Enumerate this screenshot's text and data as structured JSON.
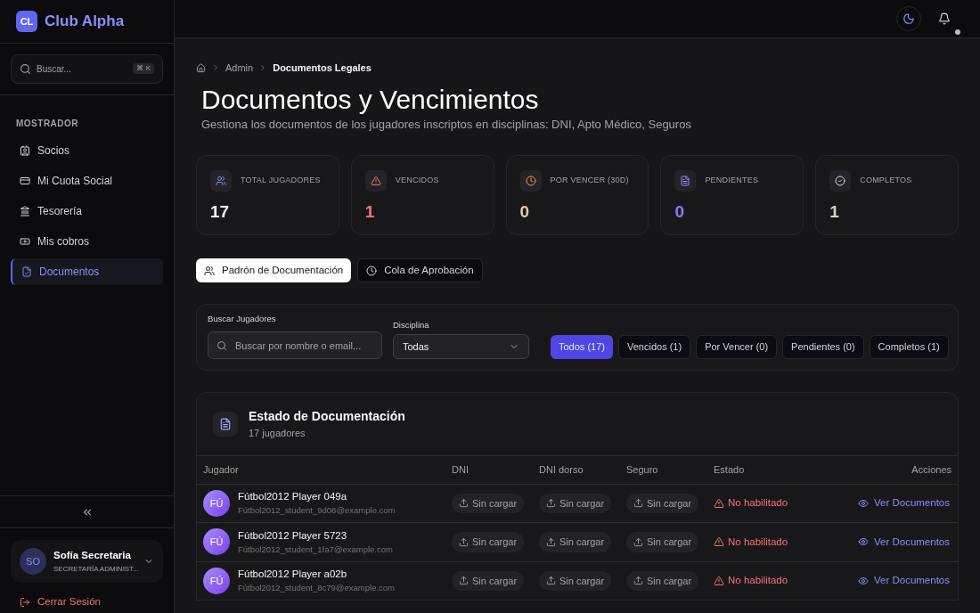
{
  "brand": {
    "logo": "CL",
    "name": "Club Alpha"
  },
  "sidebar": {
    "search": {
      "placeholder": "Buscar...",
      "shortcut": "⌘ K"
    },
    "section": "MOSTRADOR",
    "items": [
      {
        "label": "Socios",
        "selected": false
      },
      {
        "label": "Mi Cuota Social",
        "selected": false
      },
      {
        "label": "Tesorería",
        "selected": false
      },
      {
        "label": "Mis cobros",
        "selected": false
      },
      {
        "label": "Documentos",
        "selected": true
      }
    ],
    "user": {
      "initials": "SO",
      "name": "Sofía Secretaria",
      "role": "SECRETARÍA ADMINIST..."
    },
    "logout": "Cerrar Sesión"
  },
  "breadcrumb": [
    "Admin",
    "Documentos Legales"
  ],
  "title": "Documentos y Vencimientos",
  "subtitle": "Gestiona los documentos de los jugadores inscriptos en disciplinas: DNI, Apto Médico, Seguros",
  "stats": [
    {
      "label": "TOTAL JUGADORES",
      "value": "17",
      "color": "#f4f4f5"
    },
    {
      "label": "VENCIDOS",
      "value": "1",
      "color": "#f87171"
    },
    {
      "label": "POR VENCER (30D)",
      "value": "0",
      "color": "#e5c9a8"
    },
    {
      "label": "PENDIENTES",
      "value": "0",
      "color": "#8b7cf6"
    },
    {
      "label": "COMPLETOS",
      "value": "1",
      "color": "#d6d3c4"
    }
  ],
  "tabs": [
    {
      "label": "Padrón de Documentación",
      "selected": true
    },
    {
      "label": "Cola de Aprobación",
      "selected": false
    }
  ],
  "filters": {
    "search_label": "Buscar Jugadores",
    "search_placeholder": "Buscar por nombre o email...",
    "discipline_label": "Disciplina",
    "discipline_value": "Todas",
    "chips": [
      {
        "label": "Todos (17)",
        "selected": true
      },
      {
        "label": "Vencidos (1)",
        "selected": false
      },
      {
        "label": "Por Vencer (0)",
        "selected": false
      },
      {
        "label": "Pendientes (0)",
        "selected": false
      },
      {
        "label": "Completos (1)",
        "selected": false
      }
    ]
  },
  "table": {
    "title": "Estado de Documentación",
    "subtitle": "17 jugadores",
    "columns": [
      "Jugador",
      "DNI",
      "DNI dorso",
      "Seguro",
      "Estado",
      "Acciones"
    ],
    "rows": [
      {
        "initials": "FÚ",
        "name": "Fútbol2012 Player 049a",
        "email": "Fútbol2012_student_9d08@example.com",
        "dni": "Sin cargar",
        "dni_back": "Sin cargar",
        "insurance": "Sin cargar",
        "status": "No habilitado",
        "action": "Ver Documentos"
      },
      {
        "initials": "FÚ",
        "name": "Fútbol2012 Player 5723",
        "email": "Fútbol2012_student_1fa7@example.com",
        "dni": "Sin cargar",
        "dni_back": "Sin cargar",
        "insurance": "Sin cargar",
        "status": "No habilitado",
        "action": "Ver Documentos"
      },
      {
        "initials": "FÚ",
        "name": "Fútbol2012 Player a02b",
        "email": "Fútbol2012_student_8c79@example.com",
        "dni": "Sin cargar",
        "dni_back": "Sin cargar",
        "insurance": "Sin cargar",
        "status": "No habilitado",
        "action": "Ver Documentos"
      }
    ]
  }
}
